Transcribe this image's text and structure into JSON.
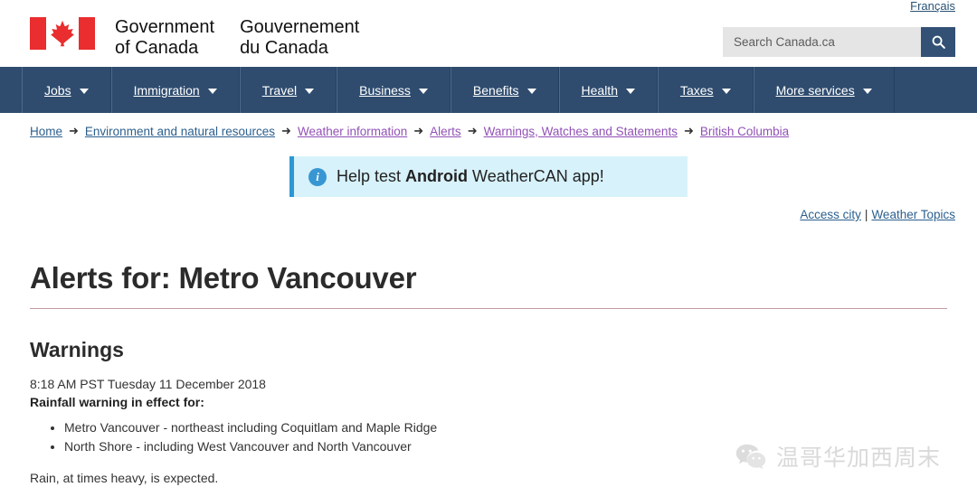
{
  "header": {
    "lang_link": "Français",
    "wordmark_en": "Government\nof Canada",
    "wordmark_en_line1": "Government",
    "wordmark_en_line2": "of Canada",
    "wordmark_fr_line1": "Gouvernement",
    "wordmark_fr_line2": "du Canada",
    "flag_icon": "canada-flag-icon",
    "search": {
      "placeholder": "Search Canada.ca",
      "value": "",
      "button_icon": "search-icon"
    }
  },
  "mainnav": {
    "items": [
      {
        "label": "Jobs",
        "icon": "chevron-down-icon"
      },
      {
        "label": "Immigration",
        "icon": "chevron-down-icon"
      },
      {
        "label": "Travel",
        "icon": "chevron-down-icon"
      },
      {
        "label": "Business",
        "icon": "chevron-down-icon"
      },
      {
        "label": "Benefits",
        "icon": "chevron-down-icon"
      },
      {
        "label": "Health",
        "icon": "chevron-down-icon"
      },
      {
        "label": "Taxes",
        "icon": "chevron-down-icon"
      },
      {
        "label": "More services",
        "icon": "chevron-down-icon"
      }
    ]
  },
  "breadcrumb": {
    "separator": "➜",
    "items": [
      {
        "label": "Home",
        "state": "unvisited"
      },
      {
        "label": "Environment and natural resources",
        "state": "unvisited"
      },
      {
        "label": "Weather information",
        "state": "visited"
      },
      {
        "label": "Alerts",
        "state": "visited"
      },
      {
        "label": "Warnings, Watches and Statements",
        "state": "visited"
      },
      {
        "label": "British Columbia",
        "state": "visited"
      }
    ]
  },
  "banner": {
    "icon": "info-circle-icon",
    "text_before": "Help test ",
    "text_bold": "Android",
    "text_after": " WeatherCAN app!"
  },
  "util_links": {
    "access_city": "Access city",
    "separator": "|",
    "weather_topics": "Weather Topics"
  },
  "main": {
    "page_title": "Alerts for: Metro Vancouver",
    "section_heading": "Warnings",
    "timestamp": "8:18 AM PST Tuesday 11 December 2018",
    "effect_line": "Rainfall warning in effect for:",
    "areas": [
      "Metro Vancouver - northeast including Coquitlam and Maple Ridge",
      "North Shore - including West Vancouver and North Vancouver"
    ],
    "closing": "Rain, at times heavy, is expected."
  },
  "watermark": {
    "icon": "wechat-logo-icon",
    "text": "温哥华加西周末"
  },
  "colors": {
    "nav_background": "#2f4c6f",
    "search_button": "#335075",
    "banner_background": "#d7f2fb",
    "banner_border": "#2b98d4",
    "link_unvisited": "#2b5f8e",
    "link_visited": "#9151b6",
    "title_rule": "#c49a9f",
    "flag_red": "#ea2d2e"
  }
}
